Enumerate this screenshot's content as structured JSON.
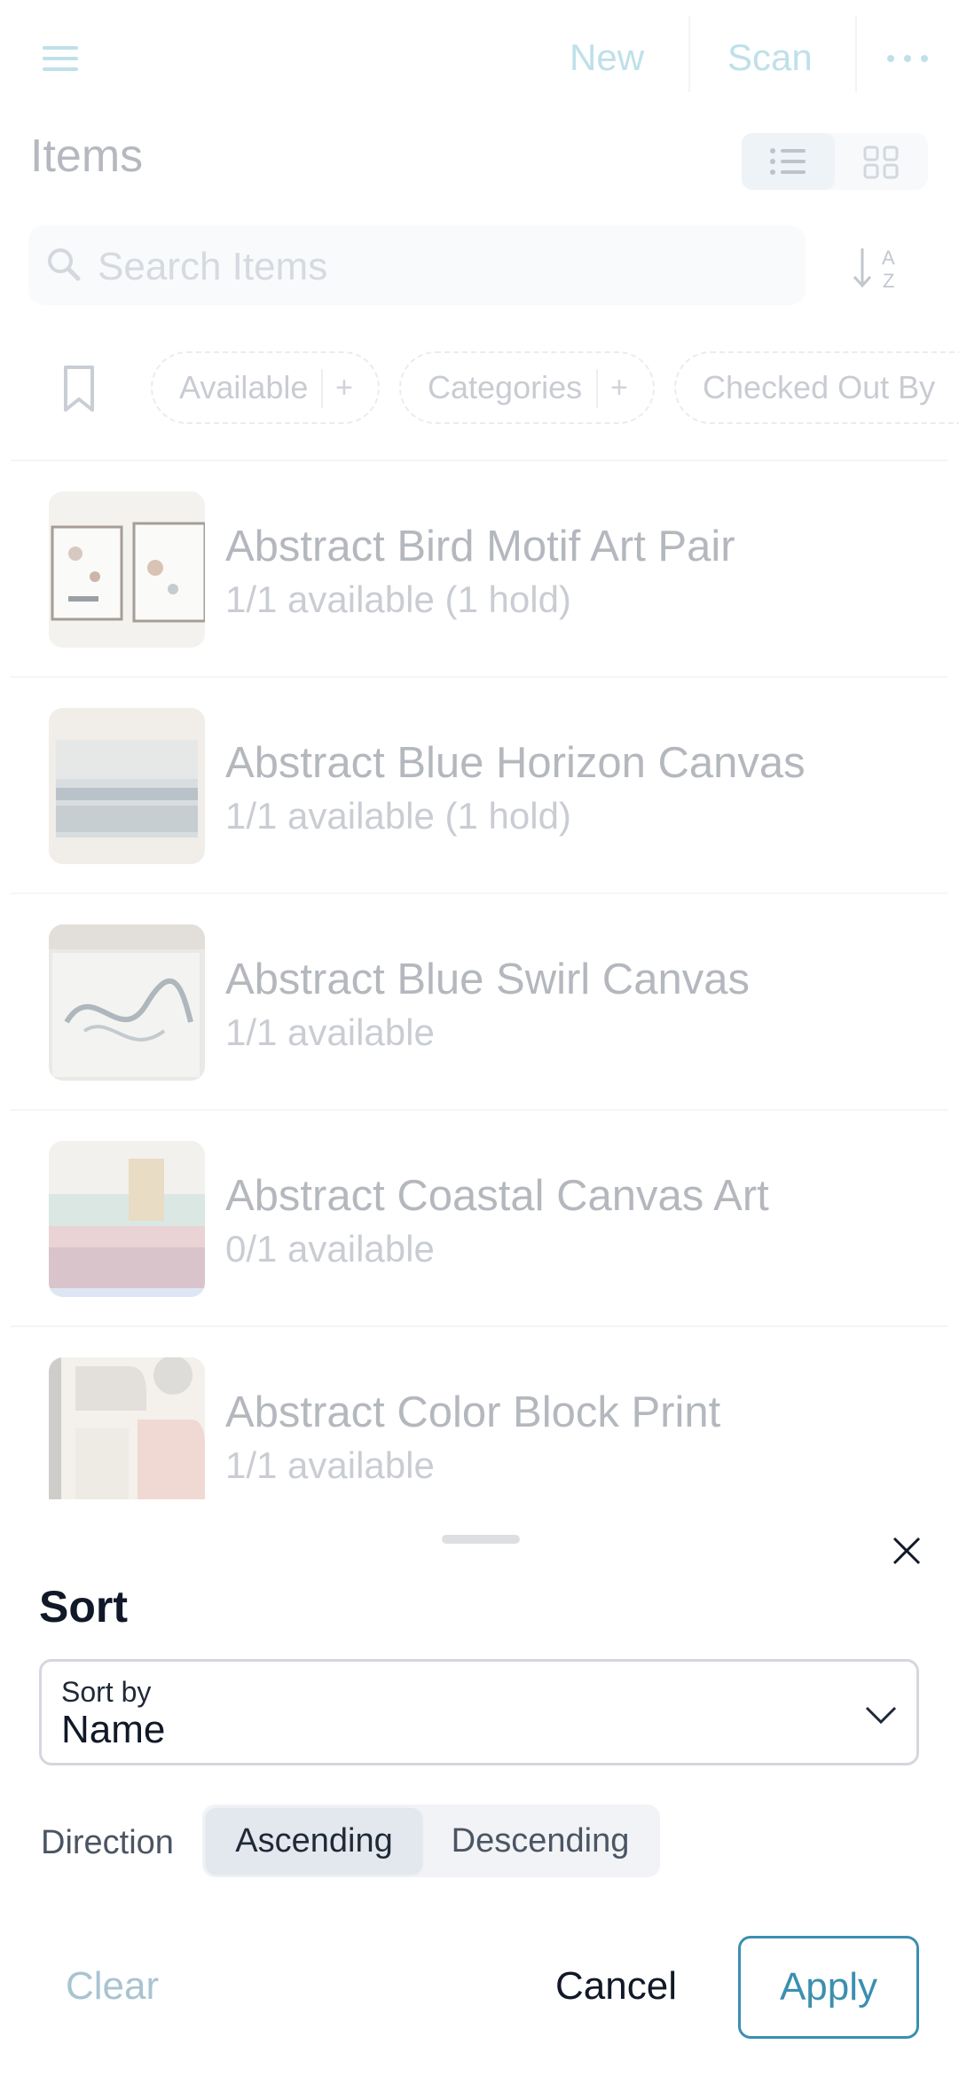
{
  "topbar": {
    "menu_icon": "hamburger-menu-icon",
    "new_label": "New",
    "scan_label": "Scan",
    "more_icon": "more-horizontal-icon"
  },
  "page": {
    "title": "Items",
    "list_view_icon": "list-view-icon",
    "grid_view_icon": "grid-view-icon",
    "active_view": "list"
  },
  "search": {
    "placeholder": "Search Items",
    "icon": "search-icon",
    "sort_icon": "sort-alpha-icon",
    "sort_icon_letters": [
      "A",
      "Z"
    ]
  },
  "filters": {
    "bookmark_icon": "bookmark-icon",
    "chips": [
      {
        "label": "Available",
        "plus": "+"
      },
      {
        "label": "Categories",
        "plus": "+"
      },
      {
        "label": "Checked Out By",
        "plus": ""
      }
    ]
  },
  "items": [
    {
      "name": "Abstract Bird Motif Art Pair",
      "availability": "1/1 available (1 hold)"
    },
    {
      "name": "Abstract Blue Horizon Canvas",
      "availability": "1/1 available (1 hold)"
    },
    {
      "name": "Abstract Blue Swirl Canvas",
      "availability": "1/1 available"
    },
    {
      "name": "Abstract Coastal Canvas Art",
      "availability": "0/1 available"
    },
    {
      "name": "Abstract Color Block Print",
      "availability": "1/1 available"
    }
  ],
  "sort_sheet": {
    "title": "Sort",
    "close_icon": "close-icon",
    "sort_by_label": "Sort by",
    "sort_by_value": "Name",
    "chevron_icon": "chevron-down-icon",
    "direction_label": "Direction",
    "direction_options": [
      "Ascending",
      "Descending"
    ],
    "direction_selected": "Ascending",
    "clear_label": "Clear",
    "cancel_label": "Cancel",
    "apply_label": "Apply"
  },
  "colors": {
    "accent": "#3b8fb0",
    "accent_faded": "#bfe0ea",
    "text_dark": "#111827"
  }
}
